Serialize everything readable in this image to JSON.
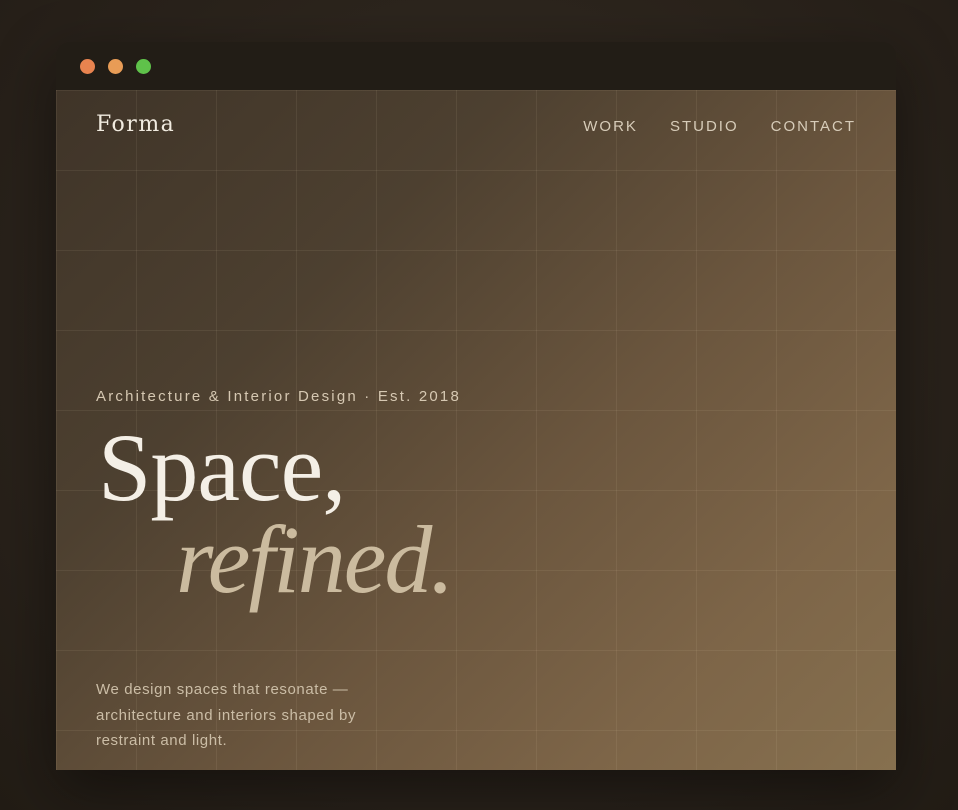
{
  "colors": {
    "dot_close": "#e8834f",
    "dot_minimize": "#e89c56",
    "dot_maximize": "#5fc24a"
  },
  "site": {
    "logo": "Forma"
  },
  "nav": {
    "items": [
      {
        "label": "WORK"
      },
      {
        "label": "STUDIO"
      },
      {
        "label": "CONTACT"
      }
    ]
  },
  "hero": {
    "eyebrow": "Architecture & Interior Design · Est. 2018",
    "headline_line1": "Space,",
    "headline_line2": "refined.",
    "description": "We design spaces that resonate — architecture and interiors shaped by restraint and light."
  }
}
